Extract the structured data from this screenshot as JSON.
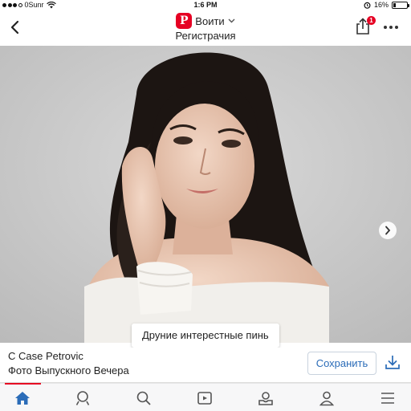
{
  "status_bar": {
    "carrier": "0Sunr",
    "time": "1:6 PM",
    "battery_percent": "16%",
    "battery_level": 0.16
  },
  "header": {
    "login_label": "Воити",
    "subtitle": "Регистрачия",
    "logo_letter": "P",
    "share_badge_count": "1"
  },
  "photo": {
    "more_pins_label": "Друние интерестные пинь"
  },
  "pin": {
    "author": "C Case Petrovic",
    "board": "Фото Выпускного Вечера",
    "save_label": "Сохранить"
  },
  "nav": {
    "items": [
      {
        "icon": "home-icon",
        "active": true
      },
      {
        "icon": "profile-search-icon",
        "active": false
      },
      {
        "icon": "search-icon",
        "active": false
      },
      {
        "icon": "video-icon",
        "active": false
      },
      {
        "icon": "inbox-icon",
        "active": false
      },
      {
        "icon": "user-icon",
        "active": false
      },
      {
        "icon": "menu-icon",
        "active": false
      }
    ]
  },
  "colors": {
    "brand": "#e60023",
    "accent_blue": "#2b6cb8",
    "background_photo": "#c8c8c8"
  }
}
